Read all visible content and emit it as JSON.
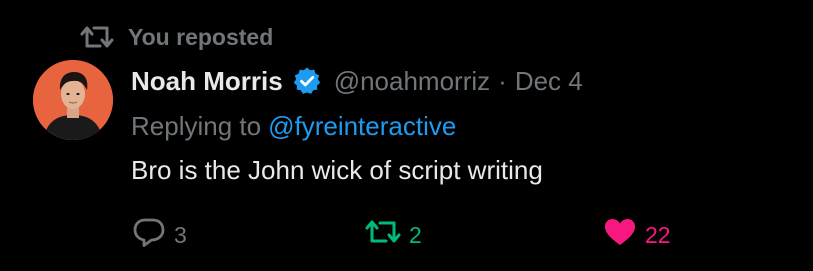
{
  "colors": {
    "background": "#000000",
    "primary_text": "#e7e9ea",
    "secondary_text": "#71767b",
    "link_blue": "#1d9bf0",
    "repost_green": "#00ba7c",
    "like_pink": "#f91880",
    "avatar_bg": "#e8643f"
  },
  "repost_banner": {
    "icon": "repost-icon",
    "label": "You reposted"
  },
  "author": {
    "avatar_icon": "avatar",
    "display_name": "Noah Morris",
    "verified_icon": "verified-badge-icon",
    "handle": "@noahmorriz",
    "separator": "·",
    "date": "Dec 4"
  },
  "reply_context": {
    "prefix": "Replying to",
    "mention": "@fyreinteractive"
  },
  "tweet": {
    "text": "Bro is the John wick of script writing"
  },
  "actions": {
    "reply": {
      "icon": "reply-icon",
      "count": "3"
    },
    "repost": {
      "icon": "repost-icon",
      "count": "2",
      "active": true
    },
    "like": {
      "icon": "heart-icon",
      "count": "22",
      "active": true
    }
  }
}
